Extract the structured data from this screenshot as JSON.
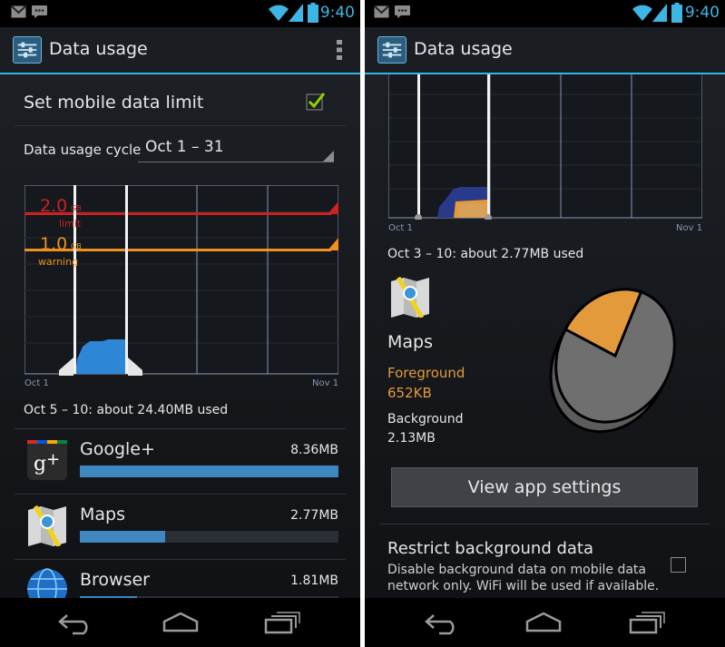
{
  "status_bar": {
    "time": "9:40"
  },
  "left_screen": {
    "header": {
      "title": "Data usage"
    },
    "mobile_limit": {
      "label": "Set mobile data limit",
      "checked": true
    },
    "cycle": {
      "label": "Data usage cycle",
      "value": "Oct 1 – 31"
    },
    "chart": {
      "limit": {
        "value": "2.0",
        "unit": "GB",
        "caption": "limit"
      },
      "warning": {
        "value": "1.0",
        "unit": "GB",
        "caption": "warning"
      },
      "x_start": "Oct 1",
      "x_end": "Nov 1"
    },
    "summary": "Oct 5 – 10: about 24.40MB used",
    "apps": [
      {
        "name": "Google+",
        "usage": "8.36MB",
        "fraction": 1.0
      },
      {
        "name": "Maps",
        "usage": "2.77MB",
        "fraction": 0.33
      },
      {
        "name": "Browser",
        "usage": "1.81MB",
        "fraction": 0.22
      }
    ]
  },
  "right_screen": {
    "header": {
      "title": "Data usage"
    },
    "chart": {
      "x_start": "Oct 1",
      "x_end": "Nov 1"
    },
    "summary": "Oct 3 – 10: about 2.77MB used",
    "app": {
      "name": "Maps",
      "foreground_label": "Foreground",
      "foreground_value": "652KB",
      "background_label": "Background",
      "background_value": "2.13MB"
    },
    "pie_chart": {
      "foreground_fraction": 0.23
    },
    "view_settings_label": "View app settings",
    "restrict": {
      "title": "Restrict background data",
      "desc_line1": "Disable background data on mobile data",
      "desc_line2": "network only. WiFi will be used if available.",
      "checked": false
    }
  },
  "colors": {
    "accent": "#33b5e5",
    "limit": "#cc2222",
    "warning": "#f0901e",
    "usage_blue": "#2d87d6",
    "bar": "#3e87c0"
  }
}
